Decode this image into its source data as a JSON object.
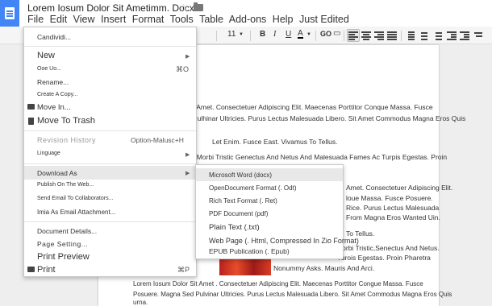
{
  "header": {
    "doc_title": "Lorem Iosum Dolor Sit Ametimm. Docx",
    "menus": [
      "File",
      "Edit",
      "View",
      "Insert",
      "Format",
      "Tools",
      "Table",
      "Add-ons",
      "Help",
      "Just Edited"
    ]
  },
  "toolbar": {
    "font_size": "11",
    "bold": "B",
    "italic": "I",
    "underline": "U",
    "text_color": "A",
    "link": "GO"
  },
  "file_menu": {
    "share": "Candividi...",
    "new": "New",
    "open": "Ooe Uo...",
    "open_shortcut": "⌘O",
    "rename": "Rename...",
    "make_copy": "Create A Copy...",
    "move_in": "Move In...",
    "move_trash": "Move To Trash",
    "revision_history": "Revision History",
    "revision_shortcut": "Option-Malusc+H",
    "language": "Linguage",
    "download_as": "Download As",
    "publish": "Publish On The Web...",
    "email_collab": "Send Email To Collaborators...",
    "email_attach": "Imia As Email Attachment...",
    "doc_details": "Document Details...",
    "page_setup": "Page Setting...",
    "print_preview": "Print Preview",
    "print": "Print",
    "print_shortcut": "⌘P"
  },
  "download_menu": {
    "word": "Microsoft Word (docx)",
    "odt": "OpenDocument Format (. Odt)",
    "rtf": "Rich Text Format (. Ret)",
    "pdf": "PDF Document (pdf)",
    "txt": "Plain Text (.txt)",
    "html": "Web Page (. Html, Compressed In Zio Format)",
    "epub": "EPUB Publication (. Epub)"
  },
  "document": {
    "lines": [
      "t Amet. Consectetuer Adipiscing Elit. Maecenas Porttitor Conque Massa. Fusce",
      "Pulhinar Ultricies. Purus Lectus Malesuada Libero. Sit Amet Commodus Magna Eros Quis",
      "Let Enim. Fusce East. Vivamus To Tellus.",
      "t Morbi Tristic Genectus And Netus And Malesuada Fames Ac Turpis Egestas. Proin",
      "Amet. Consectetuer Adipiscing Elit.",
      "loue Massa. Fusce Posuere.",
      "Rice. Purus Lectus Malesuada",
      "From Magna Eros Wanted Uin.",
      "To Tellus.",
      "Norbi Tristic,Senectus And Netus.",
      "Turois Egestas. Proin Pharetra",
      "Nonummy Asks. Mauris And Arci.",
      "Lorem Iosum Dolor Sit Amet . Consectetuer Adipiscing Elit. Maecenas Porttitor Congue Massa. Fusce",
      "Posuere. Magna Sed Pulvinar Ultricies. Purus Lectus Malesuada Libero. Sit Amet Commodus Magna Eros Quis",
      "urna."
    ]
  },
  "colors": {
    "brand_blue": "#4285f4",
    "menu_highlight": "#e8e8e8"
  }
}
